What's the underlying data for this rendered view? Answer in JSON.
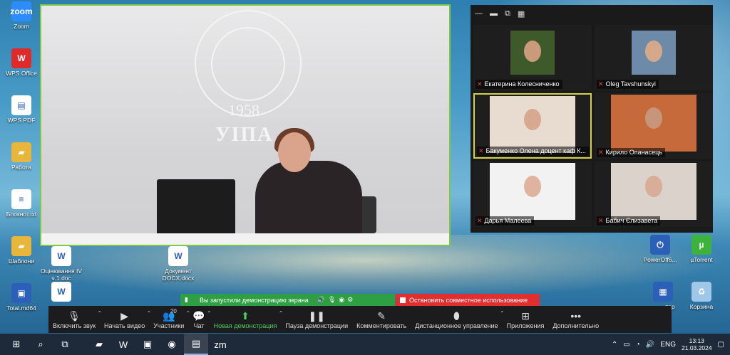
{
  "desktop": {
    "left_icons": [
      {
        "label": "Zoom",
        "icon": "zoom-app-icon",
        "color": "#2d8cff",
        "glyph": "zoom"
      },
      {
        "label": "WPS Office",
        "icon": "wps-office-icon",
        "color": "#e02a2a",
        "glyph": "W"
      },
      {
        "label": "WPS PDF",
        "icon": "pdf-file-icon",
        "color": "#ffffff",
        "glyph": "▤"
      },
      {
        "label": "Работа",
        "icon": "folder-icon",
        "color": "#e8b63a",
        "glyph": "▰"
      },
      {
        "label": "Блокнот.txt",
        "icon": "text-file-icon",
        "color": "#ffffff",
        "glyph": "≡"
      },
      {
        "label": "Шаблони",
        "icon": "template-folder-icon",
        "color": "#e8b63a",
        "glyph": "▰"
      },
      {
        "label": "Total.md64",
        "icon": "floppy-icon",
        "color": "#2b5fb8",
        "glyph": "▣"
      }
    ],
    "mid_icons": [
      {
        "label": "Оцінювання IV ч.1.doc",
        "icon": "word-doc-icon"
      },
      {
        "label": "Документ DOCX.docx",
        "icon": "word-docx-icon"
      }
    ],
    "right_icons": [
      {
        "label": "PowerOff6...",
        "icon": "poweroff-icon"
      },
      {
        "label": "µTorrent",
        "icon": "utorrent-icon"
      },
      {
        "label": "тор",
        "icon": "calculator-icon"
      },
      {
        "label": "Корзина",
        "icon": "recycle-bin-icon"
      }
    ]
  },
  "main_video": {
    "emblem_year": "1958",
    "emblem_abbr": "УІПА"
  },
  "gallery": {
    "toolbar": [
      "—",
      "▬",
      "⧉",
      "▦"
    ],
    "tiles": [
      {
        "name": "Екатерина Колесниченко",
        "bg": "#3f5a2a",
        "face": "#c99a7c",
        "active": false
      },
      {
        "name": "Oleg Tavshunskyi",
        "bg": "#6d8aa8",
        "face": "#d6a88a",
        "active": false
      },
      {
        "name": "Бакуменко Олена доцент каф К...",
        "bg": "#e8dcd0",
        "face": "#d9a891",
        "active": true
      },
      {
        "name": "Кирило Опанасець",
        "bg": "#c66a3c",
        "face": "#c8957a",
        "active": false
      },
      {
        "name": "Дарья Малеева",
        "bg": "#f2f2f2",
        "face": "#e0b39e",
        "active": false
      },
      {
        "name": "Бабич Єлизавета",
        "bg": "#dad2cb",
        "face": "#d8ae98",
        "active": false
      }
    ]
  },
  "share_banner": {
    "message": "Вы запустили демонстрацию экрана",
    "stop": "Остановить совместное использование"
  },
  "toolbar": {
    "items": [
      {
        "label": "Включить звук",
        "icon": "mic-muted-icon",
        "glyph": "🎙",
        "caret": true,
        "green": false
      },
      {
        "label": "Начать видео",
        "icon": "video-off-icon",
        "glyph": "▶",
        "caret": true,
        "green": false
      },
      {
        "label": "Участники",
        "icon": "participants-icon",
        "glyph": "👥",
        "caret": true,
        "count": "20",
        "green": false
      },
      {
        "label": "Чат",
        "icon": "chat-icon",
        "glyph": "💬",
        "caret": true,
        "green": false
      },
      {
        "label": "Новая демонстрация",
        "icon": "share-screen-icon",
        "glyph": "⬆",
        "caret": true,
        "green": true
      },
      {
        "label": "Пауза демонстрации",
        "icon": "pause-icon",
        "glyph": "❚❚",
        "caret": false,
        "green": false
      },
      {
        "label": "Комментировать",
        "icon": "annotate-pen-icon",
        "glyph": "✎",
        "caret": false,
        "green": false
      },
      {
        "label": "Дистанционное управление",
        "icon": "remote-control-mouse-icon",
        "glyph": "⬮",
        "caret": true,
        "green": false
      },
      {
        "label": "Приложения",
        "icon": "apps-icon",
        "glyph": "⊞",
        "caret": false,
        "green": false
      },
      {
        "label": "Дополнительно",
        "icon": "more-icon",
        "glyph": "•••",
        "caret": false,
        "green": false
      }
    ]
  },
  "taskbar": {
    "apps": [
      {
        "icon": "windows-start-icon",
        "glyph": "⊞"
      },
      {
        "icon": "search-icon",
        "glyph": "⌕"
      },
      {
        "icon": "task-view-icon",
        "glyph": "⧉"
      },
      {
        "icon": "file-explorer-icon",
        "glyph": "▰"
      },
      {
        "icon": "wps-taskbar-icon",
        "glyph": "W"
      },
      {
        "icon": "floppy-taskbar-icon",
        "glyph": "▣"
      },
      {
        "icon": "chrome-icon",
        "glyph": "◉"
      },
      {
        "icon": "active-app-icon",
        "glyph": "▤",
        "active": true
      },
      {
        "icon": "zoom-taskbar-icon",
        "glyph": "zm"
      }
    ],
    "language": "ENG",
    "time": "13:13",
    "date": "21.03.2024"
  }
}
